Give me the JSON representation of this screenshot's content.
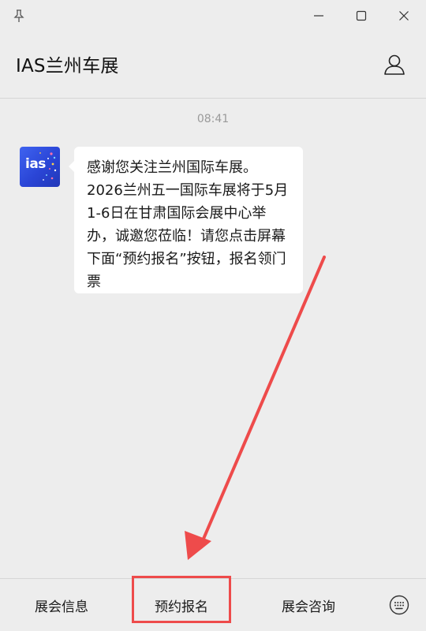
{
  "window": {
    "title": "IAS兰州车展"
  },
  "chat": {
    "timestamp": "08:41",
    "message": "感谢您关注兰州国际车展。\n2026兰州五一国际车展将于5月1-6日在甘肃国际会展中心举办，诚邀您莅临！请您点击屏幕下面“预约报名”按钮，报名领门票",
    "avatar_text": "ias"
  },
  "menu": {
    "items": [
      {
        "label": "展会信息"
      },
      {
        "label": "预约报名"
      },
      {
        "label": "展会咨询"
      }
    ]
  },
  "colors": {
    "background": "#ededed",
    "bubble": "#ffffff",
    "highlight": "#ee4b4b",
    "avatar": "#2a45d6"
  },
  "icons": [
    "pin-icon",
    "minimize-icon",
    "maximize-icon",
    "close-icon",
    "profile-icon",
    "keyboard-icon"
  ]
}
